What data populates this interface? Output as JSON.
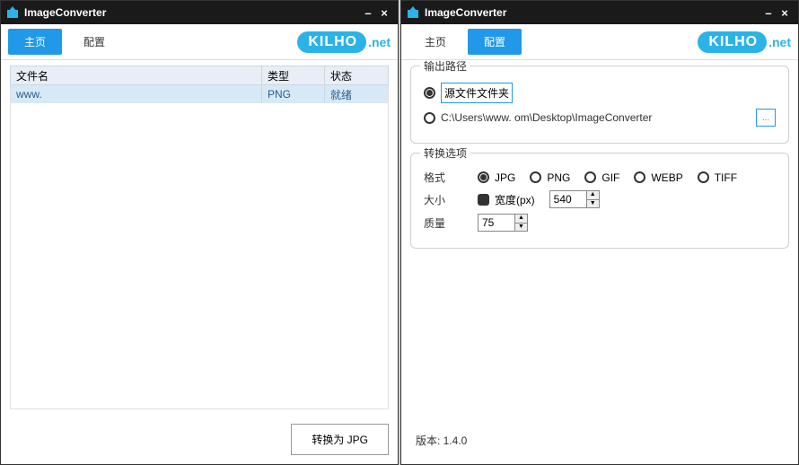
{
  "app_title": "ImageConverter",
  "logo": {
    "text": "KILHO",
    "suffix": ".net"
  },
  "left": {
    "tabs": {
      "main": "主页",
      "config": "配置"
    },
    "columns": {
      "name": "文件名",
      "type": "类型",
      "status": "状态"
    },
    "rows": [
      {
        "name": "www.",
        "type": "PNG",
        "status": "就绪"
      }
    ],
    "convert_btn": "转换为 JPG"
  },
  "right": {
    "tabs": {
      "main": "主页",
      "config": "配置"
    },
    "groups": {
      "output": {
        "title": "输出路径",
        "opt_source": "源文件文件夹",
        "opt_custom": "C:\\Users\\www.         om\\Desktop\\ImageConverter",
        "browse": "..."
      },
      "options": {
        "title": "转换选项",
        "format_label": "格式",
        "formats": [
          "JPG",
          "PNG",
          "GIF",
          "WEBP",
          "TIFF"
        ],
        "size_label": "大小",
        "width_label": "宽度(px)",
        "width_value": "540",
        "quality_label": "质量",
        "quality_value": "75"
      }
    },
    "version": "版本: 1.4.0"
  }
}
